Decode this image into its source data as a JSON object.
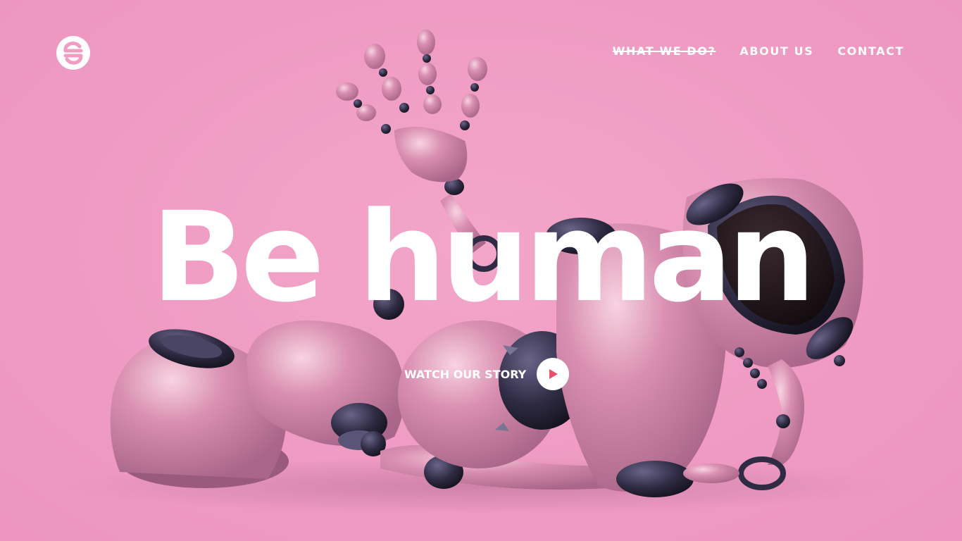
{
  "brand": {
    "logo_icon": "brand-logo-icon",
    "colors": {
      "background": "#f09cc3",
      "text": "#ffffff",
      "accent": "#e8506f"
    }
  },
  "nav": {
    "items": [
      {
        "label": "WHAT WE DO?",
        "state": "struck-through"
      },
      {
        "label": "ABOUT US"
      },
      {
        "label": "CONTACT"
      }
    ]
  },
  "hero": {
    "headline": "Be human",
    "cta_label": "WATCH OUR STORY",
    "cta_icon": "play-icon",
    "image": "pink-robot-lying-down-waving"
  }
}
